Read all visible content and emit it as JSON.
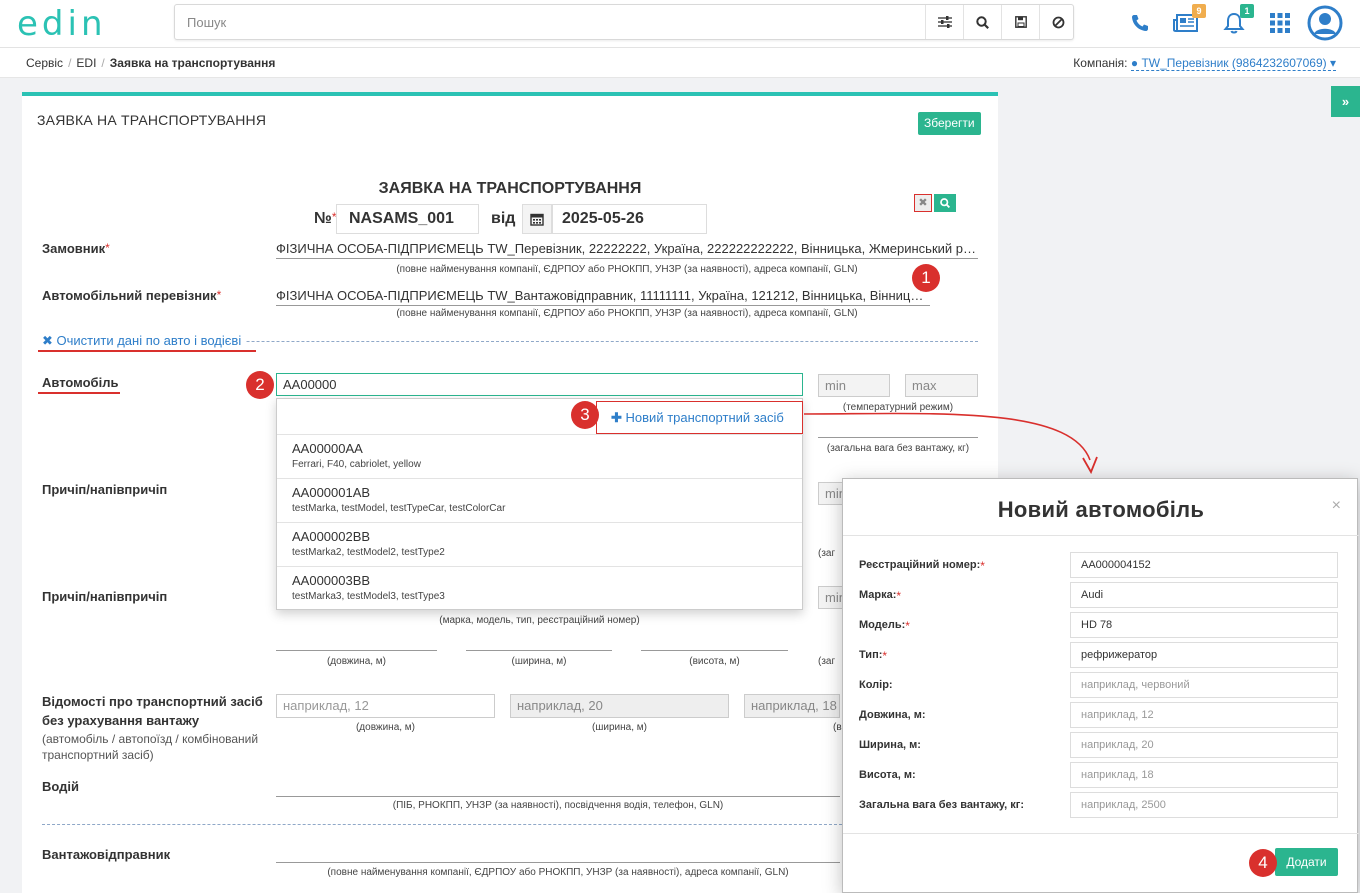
{
  "header": {
    "logo": "edin",
    "search_placeholder": "Пошук",
    "news_badge": "9",
    "notif_badge": "1",
    "colors": {
      "accent": "#2bc2b4",
      "primary": "#2bb58f",
      "link": "#2e7ec9",
      "marker": "#d9302d"
    }
  },
  "breadcrumb": {
    "items": [
      "Сервіс",
      "EDI",
      "Заявка на транспортування"
    ],
    "company_label": "Компанія:",
    "company_value": "TW_Перевізник (9864232607069)"
  },
  "card": {
    "title": "ЗАЯВКА НА ТРАНСПОРТУВАННЯ",
    "save_label": "Зберегти",
    "doc_title": "ЗАЯВКА НА ТРАНСПОРТУВАННЯ",
    "number_label": "№",
    "number_value": "NASAMS_001",
    "date_label": "від",
    "date_value": "2025-05-26"
  },
  "form": {
    "customer_label": "Замовник",
    "customer_value": "ФІЗИЧНА ОСОБА-ПІДПРИЄМЕЦЬ TW_Перевізник, 22222222, Україна, 222222222222, Вінницька, Жмеринський р-н, с. П...",
    "company_hint": "(повне найменування компанії, ЄДРПОУ або РНОКПП, УНЗР (за наявності), адреса компанії, GLN)",
    "carrier_label": "Автомобільний перевізник",
    "carrier_value": "ФІЗИЧНА ОСОБА-ПІДПРИЄМЕЦЬ TW_Вантажовідправник, 11111111, Україна, 121212, Вінницька, Вінницький ...",
    "clear_link": "Очистити дані по авто і водієві",
    "car_label": "Автомобіль",
    "car_value": "AA00000",
    "min_ph": "min",
    "max_ph": "max",
    "temp_hint": "(температурний режим)",
    "weight_hint": "(загальна вага без вантажу, кг)",
    "trailer1_label": "Причіп/напівпричіп",
    "trailer2_label": "Причіп/напівпричіп",
    "vehicle_hint": "(марка, модель, тип, реєстраційний номер)",
    "len_hint": "(довжина, м)",
    "width_hint": "(ширина, м)",
    "height_hint": "(висота, м)",
    "weight_short": "(заг",
    "min_cut": "min",
    "info_label_1": "Відомості про транспортний засіб",
    "info_label_2": "без урахування вантажу",
    "info_sub": "(автомобіль / автопоїзд / комбінований транспортний засіб)",
    "info_len_ph": "наприклад, 12",
    "info_width_ph": "наприклад, 20",
    "info_height_ph": "наприклад, 18",
    "info_len_hint": "(довжина, м)",
    "info_width_hint": "(ширина, м)",
    "info_cut_hint": "(в",
    "driver_label": "Водій",
    "driver_hint": "(ПІБ, РНОКПП, УНЗР (за наявності), посвідчення водія, телефон, GLN)",
    "shipper_label": "Вантажовідправник",
    "shipper_hint": "(повне найменування компанії, ЄДРПОУ або РНОКПП, УНЗР (за наявності), адреса компанії, GLN)"
  },
  "dropdown": {
    "new_label": "Новий транспортний засіб",
    "items": [
      {
        "title": "AA00000AA",
        "sub": "Ferrari, F40, cabriolet, yellow"
      },
      {
        "title": "AA000001AB",
        "sub": "testMarka, testModel, testTypeCar, testColorCar"
      },
      {
        "title": "AA000002BB",
        "sub": "testMarka2, testModel2, testType2"
      },
      {
        "title": "AA000003BB",
        "sub": "testMarka3, testModel3, testType3"
      }
    ]
  },
  "modal": {
    "title": "Новий автомобіль",
    "close": "×",
    "fields": [
      {
        "label": "Реєстраційний номер:",
        "required": true,
        "value": "AA000004152",
        "placeholder": ""
      },
      {
        "label": "Марка:",
        "required": true,
        "value": "Audi",
        "placeholder": ""
      },
      {
        "label": "Модель:",
        "required": true,
        "value": "HD 78",
        "placeholder": ""
      },
      {
        "label": "Тип:",
        "required": true,
        "value": "рефрижератор",
        "placeholder": ""
      },
      {
        "label": "Колір:",
        "required": false,
        "value": "",
        "placeholder": "наприклад, червоний"
      },
      {
        "label": "Довжина, м:",
        "required": false,
        "value": "",
        "placeholder": "наприклад, 12"
      },
      {
        "label": "Ширина, м:",
        "required": false,
        "value": "",
        "placeholder": "наприклад, 20"
      },
      {
        "label": "Висота, м:",
        "required": false,
        "value": "",
        "placeholder": "наприклад, 18"
      },
      {
        "label": "Загальна вага без вантажу, кг:",
        "required": false,
        "value": "",
        "placeholder": "наприклад, 2500"
      }
    ],
    "add_label": "Додати"
  },
  "markers": [
    "1",
    "2",
    "3",
    "4"
  ]
}
